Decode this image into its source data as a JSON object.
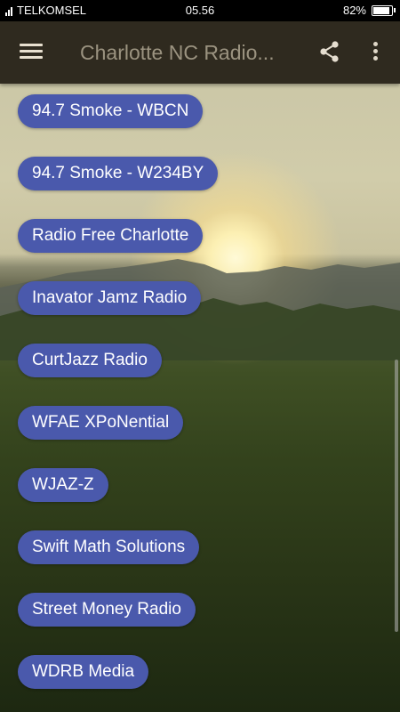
{
  "status_bar": {
    "carrier": "TELKOMSEL",
    "time": "05.56",
    "battery_percent": "82%",
    "battery_level": 0.82
  },
  "app_bar": {
    "title": "Charlotte NC Radio...",
    "menu_icon": "hamburger-menu-icon",
    "share_icon": "share-icon",
    "more_icon": "more-vert-icon"
  },
  "colors": {
    "app_bar": "#2f2a1f",
    "station_button": "#4a59ac",
    "station_text": "#ffffff"
  },
  "stations": [
    "94.7 Smoke - WBCN",
    "94.7 Smoke - W234BY",
    "Radio Free Charlotte",
    "Inavator Jamz Radio",
    "CurtJazz Radio",
    "WFAE XPoNential",
    "WJAZ-Z",
    "Swift Math Solutions",
    "Street Money Radio",
    "WDRB Media"
  ]
}
